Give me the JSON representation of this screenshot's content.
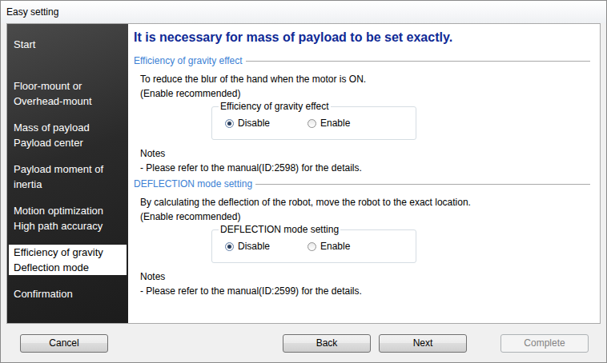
{
  "window": {
    "title": "Easy setting"
  },
  "sidebar": {
    "items": [
      {
        "lines": [
          "Start"
        ],
        "selected": false
      },
      {
        "lines": [
          "Floor-mount or",
          "Overhead-mount"
        ],
        "selected": false
      },
      {
        "lines": [
          "Mass of payload",
          "Payload center"
        ],
        "selected": false
      },
      {
        "lines": [
          "Payload moment of",
          "inertia"
        ],
        "selected": false
      },
      {
        "lines": [
          "Motion optimization",
          "High path accuracy"
        ],
        "selected": false
      },
      {
        "lines": [
          "Efficiency of gravity",
          "Deflection mode"
        ],
        "selected": true
      },
      {
        "lines": [
          "Confirmation"
        ],
        "selected": false
      }
    ]
  },
  "heading": "It is necessary for mass of payload to be set exactly.",
  "sections": [
    {
      "title": "Efficiency of gravity effect",
      "description": [
        "To reduce the blur of the hand when the motor is ON.",
        "(Enable recommended)"
      ],
      "group": {
        "title": "Efficiency of gravity effect",
        "options": [
          {
            "label": "Disable",
            "selected": true
          },
          {
            "label": "Enable",
            "selected": false
          }
        ]
      },
      "notes_title": "Notes",
      "notes": [
        "- Please refer to the manual(ID:2598) for the details."
      ]
    },
    {
      "title": "DEFLECTION mode setting",
      "description": [
        "By calculating the deflection of the robot, move the robot to the exact location.",
        "(Enable recommended)"
      ],
      "group": {
        "title": "DEFLECTION mode setting",
        "options": [
          {
            "label": "Disable",
            "selected": true
          },
          {
            "label": "Enable",
            "selected": false
          }
        ]
      },
      "notes_title": "Notes",
      "notes": [
        "- Please refer to the manual(ID:2599) for the details."
      ]
    }
  ],
  "buttons": [
    {
      "label": "Cancel",
      "disabled": false
    },
    {
      "label": "Back",
      "disabled": false
    },
    {
      "label": "Next",
      "disabled": false
    },
    {
      "label": "Complete",
      "disabled": true
    }
  ]
}
